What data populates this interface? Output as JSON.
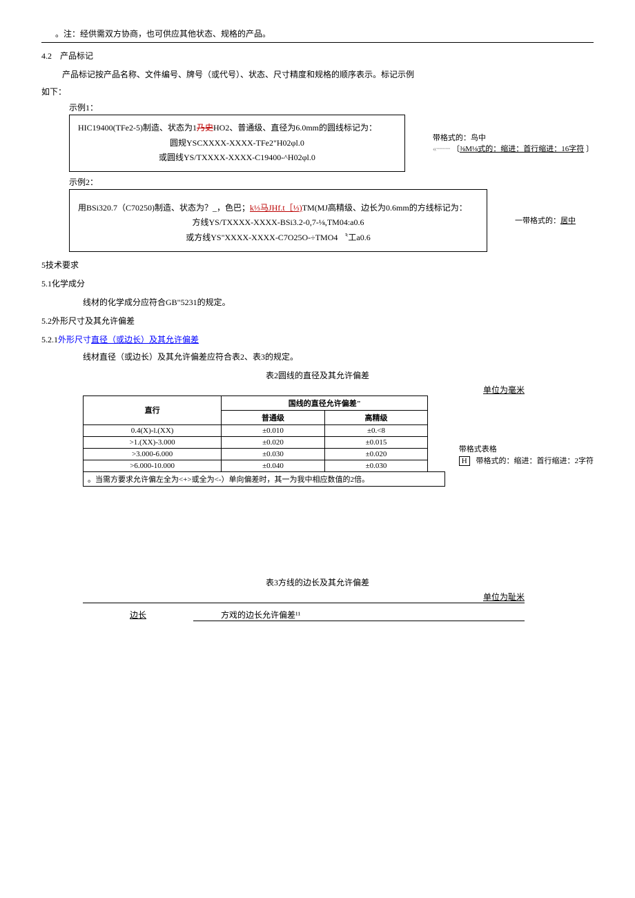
{
  "top_note": "。注：经供需双方协商，也可供应其他状态、规格的产品。",
  "s42": {
    "num": "4.2",
    "title": "产品标记",
    "body1": "产品标记按产品名称、文件编号、牌号（或代号）、状态、尺寸精度和规格的顺序表示。标记示例",
    "body2": "如下："
  },
  "example1": {
    "label": "示例1：",
    "line1_a": "HIC19400(TFe2-5)制造、状态为1",
    "line1_del": "乃史",
    "line1_b": "HO2、普通级、直径为6.0mm的圆线标记为：",
    "line2": "圆规YSCXXXX-XXXX-TFe2\"H02φl.0",
    "line3": "或圆线YS/TXXXX-XXXX-C19400-^H02φl.0"
  },
  "comment1a": "带格式的：鸟中",
  "comment1b_prefix": "⅜M⅛式的：缩进：首行缩进：16字符",
  "example2": {
    "label": "示例2：",
    "line1_a": "用BSi320.7（C70250)制造、状态为？_，色巴；",
    "line1_ul": "k⅓马JHf.t［⅓)",
    "line1_b": "TM(MJ高精级、边长为0.6mm的方线标记为：",
    "line2": "方线YS/TXXXX-XXXX-BSi3.2-0,7-⅛,TM04:a0.6",
    "line3": "或方线YS\"XXXX-XXXX-C7O25O-÷TMO4 〝工a0.6"
  },
  "comment2": "一带格式的：居中",
  "s5": "5技术要求",
  "s51": "5.1化学成分",
  "s51_body": "线材的化学成分应符合GB\"5231的规定。",
  "s52": "5.2外形尺寸及其允许偏差",
  "s521_a": "5.2.1",
  "s521_b": "外形尺寸",
  "s521_c": "直径（或边长）及其允许偏差",
  "s521_body": "线材直径（或边长）及其允许偏差应符合表2、表3的规定。",
  "table2": {
    "title": "表2圆线的直径及其允许偏差",
    "unit": "单位为毫米",
    "h1": "直行",
    "h2": "国线的直径允许偏差\"",
    "h2a": "普通级",
    "h2b": "高精级",
    "rows": [
      {
        "c1": "0.4(X)-l.(XX)",
        "c2": "±0.010",
        "c3": "±0.<8"
      },
      {
        "c1": ">1.(XX)-3.000",
        "c2": "±0.020",
        "c3": "±0.015"
      },
      {
        "c1": ">3.000-6.000",
        "c2": "±0.030",
        "c3": "±0.020"
      },
      {
        "c1": ">6.000-10.000",
        "c2": "±0.040",
        "c3": "±0.030"
      }
    ],
    "foot": "。当需方要求允许偏左全为<+>或全为<-）单向偏差时，其一为我中相应数值的2倍。"
  },
  "side_comments": {
    "a": "带格式表格",
    "b_mark": "H",
    "c": "带格式的：缩进：首行缩进：2字符"
  },
  "table3": {
    "title": "表3方线的边长及其允许偏差",
    "unit": "单位为耻米",
    "h1": "边长",
    "h2": "方戏的边长允许偏差¹¹"
  }
}
